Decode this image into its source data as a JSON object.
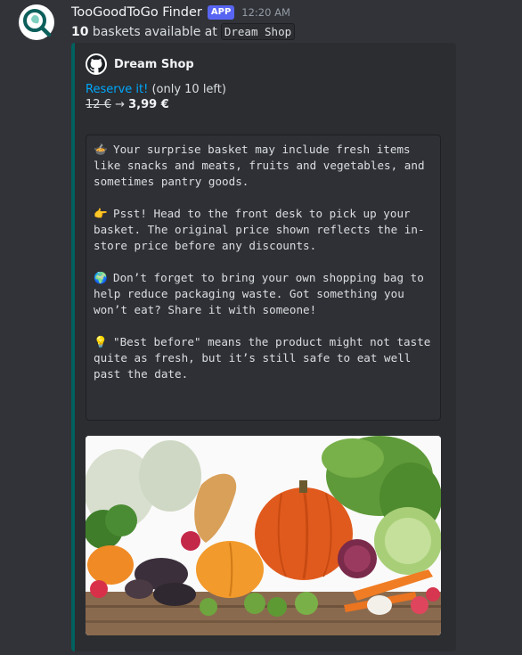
{
  "message": {
    "username": "TooGoodToGo Finder",
    "badge": "APP",
    "timestamp": "12:20 AM",
    "count": "10",
    "text_before_store": " baskets available at",
    "store_code": "Dream Shop"
  },
  "embed": {
    "accent_color": "#00615f",
    "author": "Dream Shop",
    "reserve_link": "Reserve it!",
    "reserve_suffix": " (only 10 left)",
    "old_price": "12 €",
    "arrow": " → ",
    "new_price": "3,99 €",
    "codeblock": [
      {
        "emoji": "🍲",
        "text": "Your surprise basket may include fresh items like snacks and meats, fruits and vegetables, and sometimes pantry goods."
      },
      {
        "emoji": "👉",
        "text": "Psst! Head to the front desk to pick up your basket. The original price shown reflects the in-store price before any discounts."
      },
      {
        "emoji": "🌍",
        "text": "Don’t forget to bring your own shopping bag to help reduce packaging waste. Got something you won’t eat? Share it with someone!"
      },
      {
        "emoji": "💡",
        "text": "\"Best before\" means the product might not taste quite as fresh, but it’s still safe to eat well past the date."
      }
    ]
  },
  "icons": {
    "avatar": "magnifier-leaf-icon",
    "author": "github-icon"
  }
}
